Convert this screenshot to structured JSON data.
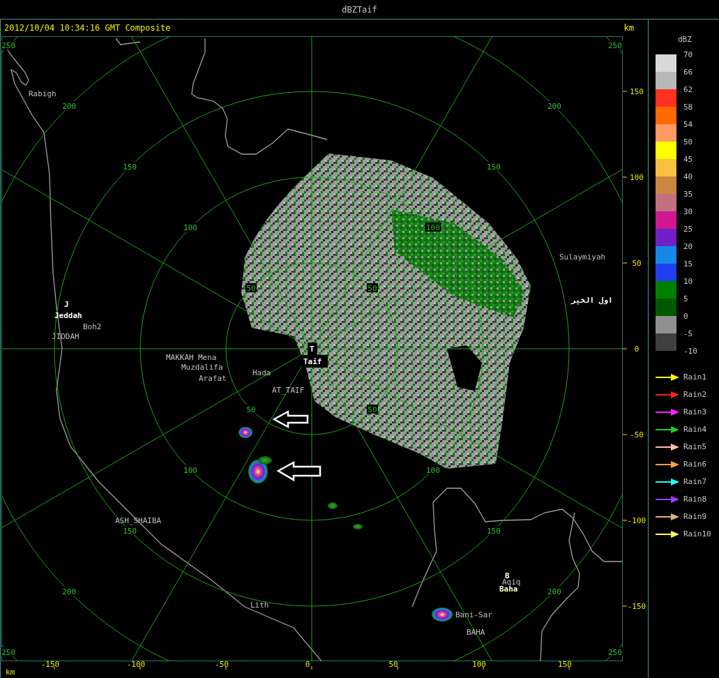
{
  "window": {
    "title": "dBZTaif"
  },
  "header": {
    "timestamp": "2012/10/04 10:34:16 GMT Composite",
    "unit": "km"
  },
  "map": {
    "range_rings": [
      {
        "labels": [
          "50",
          "50",
          "50",
          "50"
        ]
      },
      {
        "labels": [
          "100",
          "100",
          "100",
          "100"
        ]
      },
      {
        "labels": [
          "150",
          "150",
          "150",
          "150"
        ]
      },
      {
        "labels": [
          "200",
          "200",
          "200",
          "200"
        ]
      },
      {
        "labels": [
          "250",
          "250",
          "250",
          "250"
        ]
      }
    ],
    "places": [
      {
        "name": "Rabigh",
        "color": "#c0c0c0"
      },
      {
        "name": "J",
        "color": "#ffffff"
      },
      {
        "name": "Jeddah",
        "color": "#ffffff"
      },
      {
        "name": "Boh2",
        "color": "#c0c0c0"
      },
      {
        "name": "JIDDAH",
        "color": "#c0c0c0"
      },
      {
        "name": "MAKKAH",
        "color": "#c0c0c0"
      },
      {
        "name": "Mena",
        "color": "#c0c0c0"
      },
      {
        "name": "Muzdalifa",
        "color": "#c0c0c0"
      },
      {
        "name": "Arafat",
        "color": "#c0c0c0"
      },
      {
        "name": "Hada",
        "color": "#c0c0c0"
      },
      {
        "name": "AT_TAIF",
        "color": "#c0c0c0"
      },
      {
        "name": "T",
        "color": "#ffffff"
      },
      {
        "name": "Taif",
        "color": "#ffffff"
      },
      {
        "name": "Sulaymiyah",
        "color": "#c0c0c0"
      },
      {
        "name": "اول الخير",
        "color": "#ffffff"
      },
      {
        "name": "B",
        "color": "#ffffc0"
      },
      {
        "name": "Aqiq",
        "color": "#c0c0c0"
      },
      {
        "name": "Baha",
        "color": "#ffffc0"
      },
      {
        "name": "Bani-Sar",
        "color": "#c0c0c0"
      },
      {
        "name": "BAHA",
        "color": "#c0c0c0"
      },
      {
        "name": "ASH_SHAIBA",
        "color": "#c0c0c0"
      },
      {
        "name": "Lith",
        "color": "#c0c0c0"
      }
    ]
  },
  "x_axis": {
    "unit": "km",
    "ticks": [
      "-150",
      "-100",
      "-50",
      "0",
      "50",
      "100",
      "150"
    ]
  },
  "y_axis": {
    "ticks": [
      "150",
      "100",
      "50",
      "0",
      "-50",
      "-100",
      "-150"
    ]
  },
  "legend": {
    "title": "dBZ",
    "bands": [
      {
        "color": "#d8d8d8"
      },
      {
        "color": "#b8b8b8"
      },
      {
        "color": "#ff3020"
      },
      {
        "color": "#ff6a00"
      },
      {
        "color": "#ff9a60"
      },
      {
        "color": "#ffff00"
      },
      {
        "color": "#f8c040"
      },
      {
        "color": "#c88840"
      },
      {
        "color": "#c07080"
      },
      {
        "color": "#d01890"
      },
      {
        "color": "#7020c8"
      },
      {
        "color": "#1888e8"
      },
      {
        "color": "#2040f0"
      },
      {
        "color": "#008000"
      },
      {
        "color": "#005800"
      },
      {
        "color": "#909090"
      },
      {
        "color": "#404040"
      }
    ],
    "labels": [
      "70",
      "66",
      "62",
      "58",
      "54",
      "50",
      "45",
      "40",
      "35",
      "30",
      "25",
      "20",
      "15",
      "10",
      "5",
      "0",
      "-5",
      "-10"
    ],
    "rain_tracks": [
      {
        "label": "Rain1",
        "color": "#ffff00"
      },
      {
        "label": "Rain2",
        "color": "#ff2020"
      },
      {
        "label": "Rain3",
        "color": "#ff20ff"
      },
      {
        "label": "Rain4",
        "color": "#20d020"
      },
      {
        "label": "Rain5",
        "color": "#ffc0b0"
      },
      {
        "label": "Rain6",
        "color": "#ffa040"
      },
      {
        "label": "Rain7",
        "color": "#20ffff"
      },
      {
        "label": "Rain8",
        "color": "#a040ff"
      },
      {
        "label": "Rain9",
        "color": "#e0b080"
      },
      {
        "label": "Rain10",
        "color": "#ffff60"
      }
    ]
  }
}
